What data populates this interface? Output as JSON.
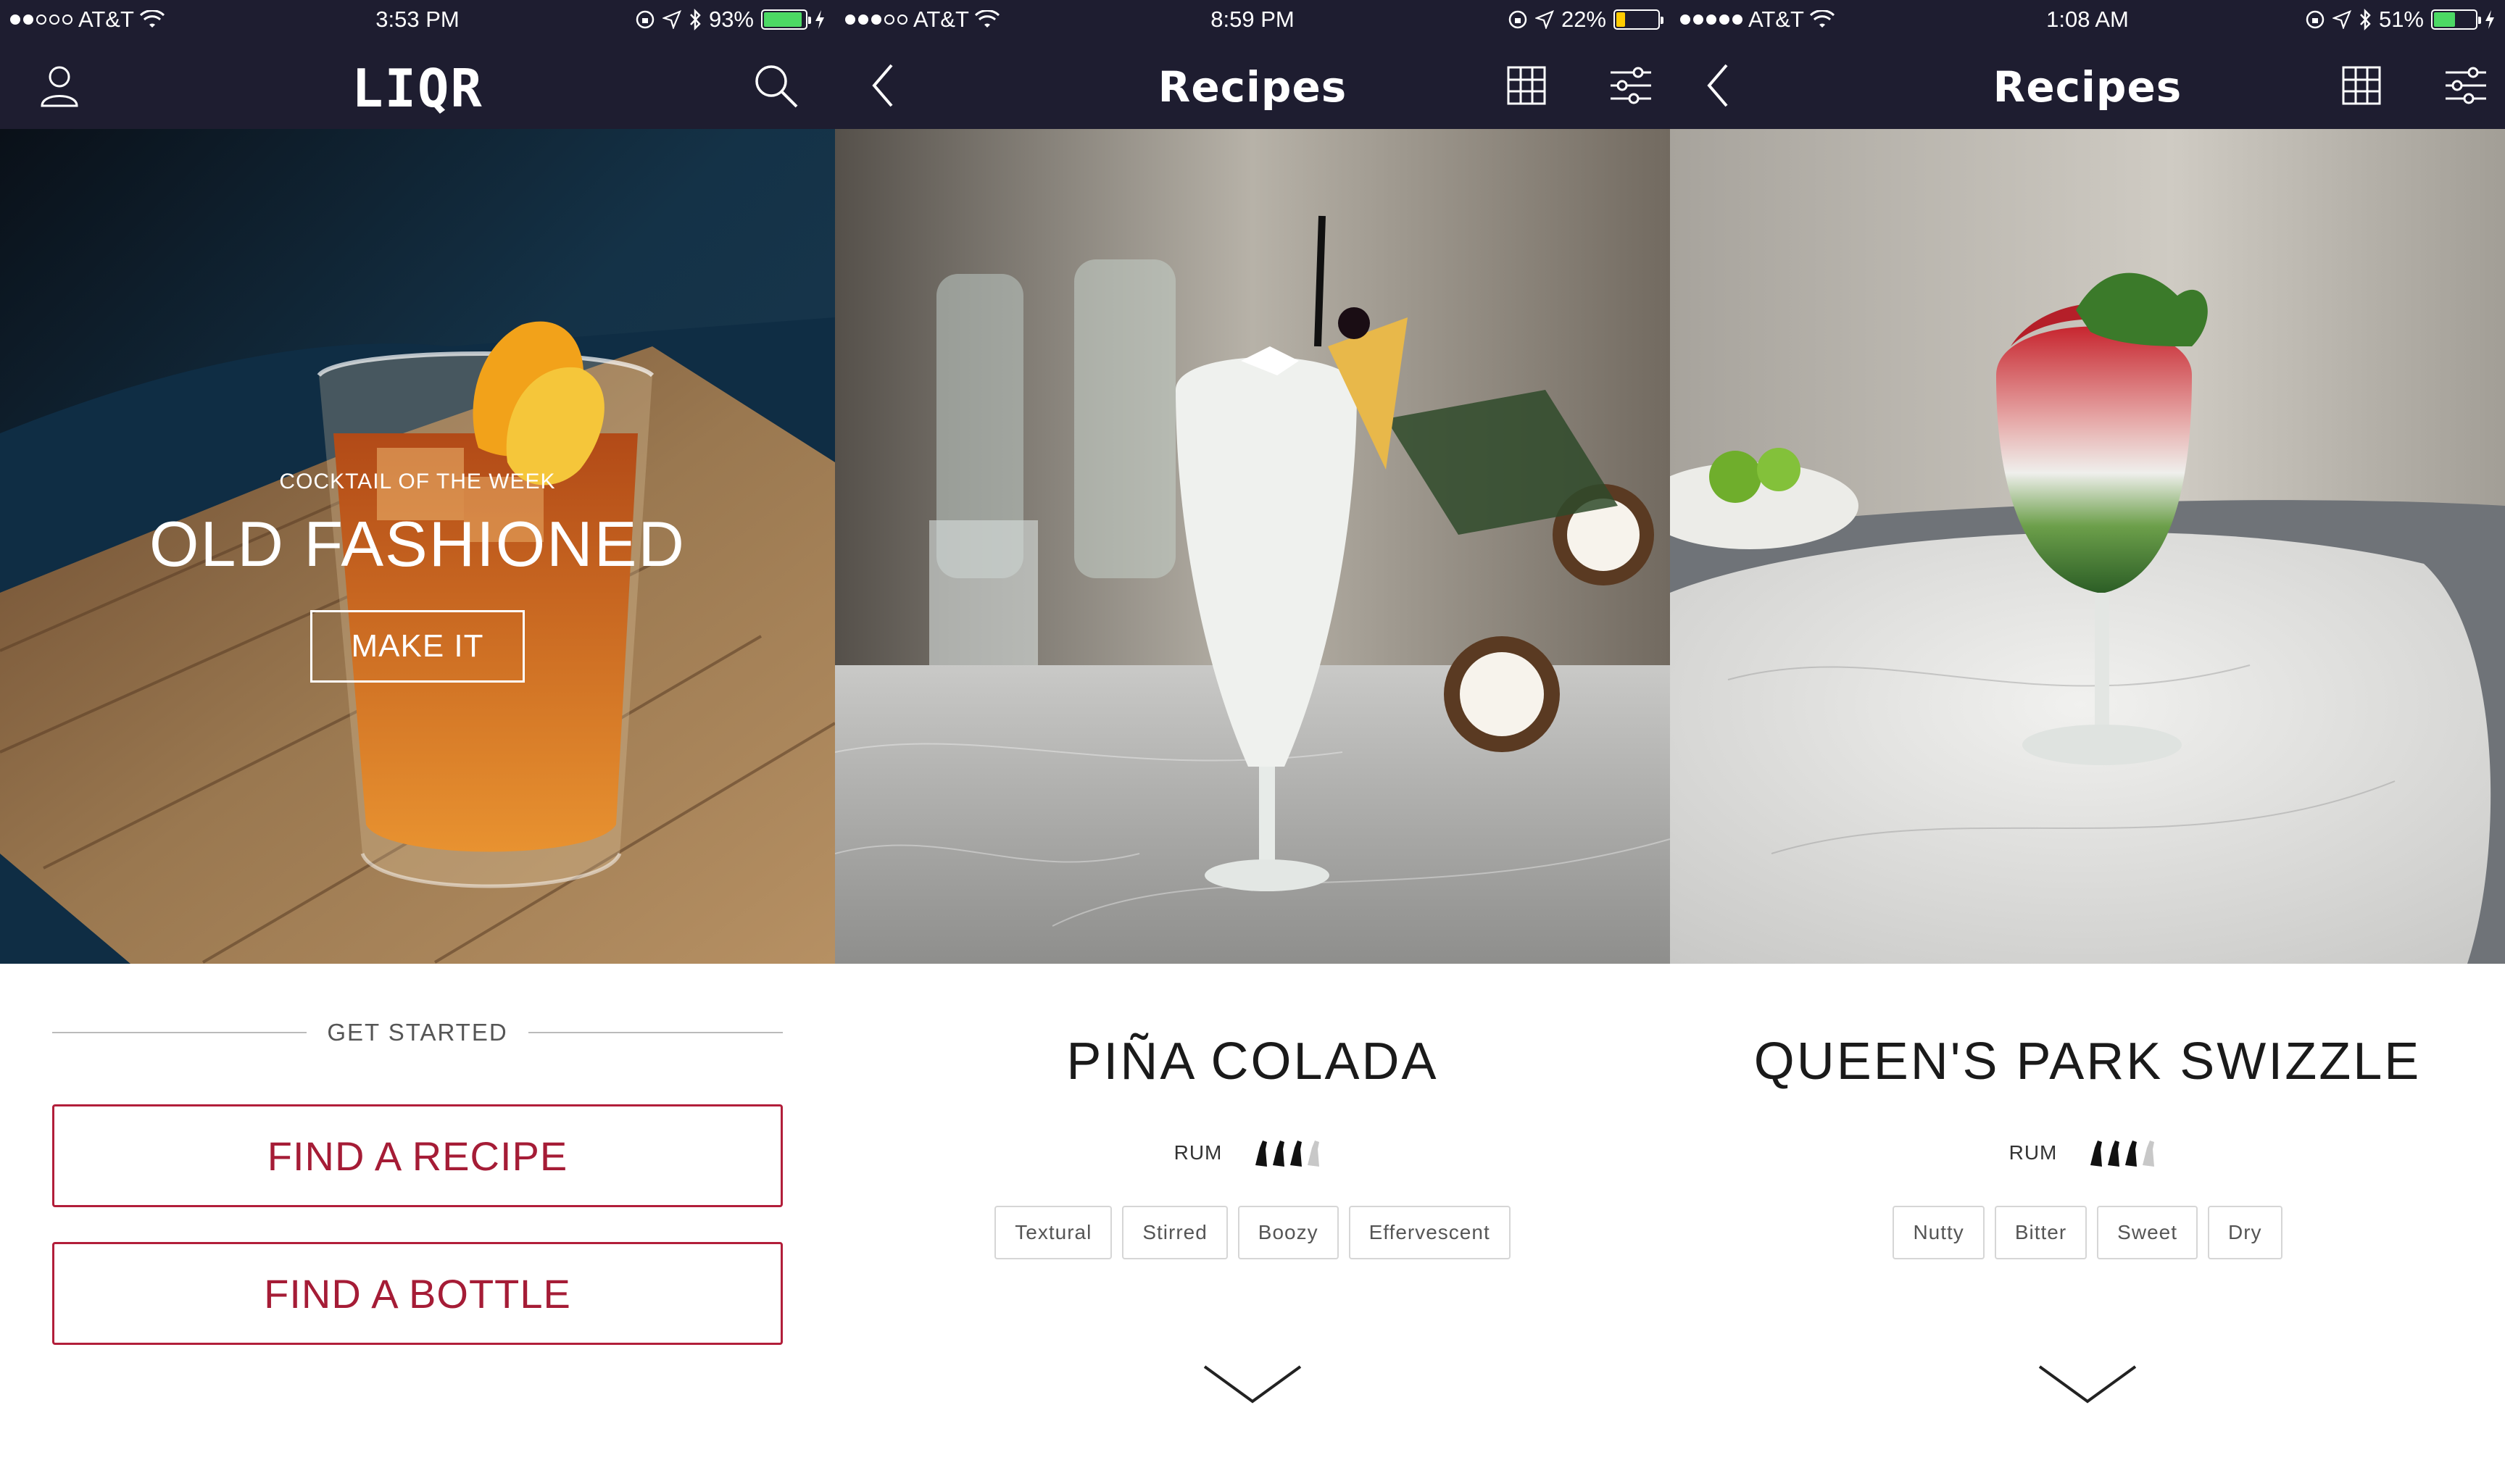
{
  "colors": {
    "nav_bg": "#1e1d30",
    "accent": "#b21e3a",
    "battery_green": "#4cd964",
    "battery_yellow": "#ffcc00"
  },
  "screens": [
    {
      "status": {
        "carrier": "AT&T",
        "signal_filled": 2,
        "time": "3:53 PM",
        "battery": "93%",
        "battery_level": 0.93,
        "battery_color": "#4cd964"
      },
      "nav": {
        "logo": "LIQR",
        "left_icon": "user-icon",
        "right_icon": "search-icon"
      },
      "hero": {
        "kicker": "COCKTAIL OF THE WEEK",
        "name": "OLD FASHIONED",
        "button": "MAKE IT"
      },
      "get_started": "GET STARTED",
      "buttons": [
        "FIND A RECIPE",
        "FIND A BOTTLE"
      ]
    },
    {
      "status": {
        "carrier": "AT&T",
        "signal_filled": 3,
        "time": "8:59 PM",
        "battery": "22%",
        "battery_level": 0.22,
        "battery_color": "#ffcc00"
      },
      "nav": {
        "title": "Recipes",
        "left_icon": "back-icon",
        "grid_icon": "grid-icon",
        "filter_icon": "filter-icon"
      },
      "recipe": {
        "name": "PIÑA COLADA",
        "spirit": "RUM",
        "strength": 3,
        "strength_max": 4,
        "tags": [
          "Textural",
          "Stirred",
          "Boozy",
          "Effervescent"
        ]
      }
    },
    {
      "status": {
        "carrier": "AT&T",
        "signal_filled": 5,
        "time": "1:08 AM",
        "battery": "51%",
        "battery_level": 0.51,
        "battery_color": "#4cd964"
      },
      "nav": {
        "title": "Recipes",
        "left_icon": "back-icon",
        "grid_icon": "grid-icon",
        "filter_icon": "filter-icon"
      },
      "recipe": {
        "name": "QUEEN'S PARK SWIZZLE",
        "spirit": "RUM",
        "strength": 3,
        "strength_max": 4,
        "tags": [
          "Nutty",
          "Bitter",
          "Sweet",
          "Dry"
        ]
      }
    }
  ]
}
